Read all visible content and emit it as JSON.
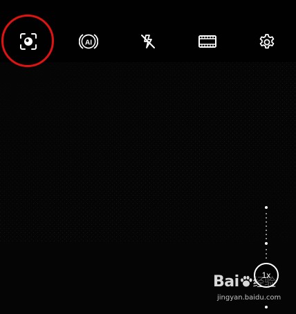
{
  "top_bar": {
    "items": [
      {
        "id": "portrait-focus",
        "icon": "face-frame-icon"
      },
      {
        "id": "ai",
        "icon": "ai-icon",
        "label": "AI"
      },
      {
        "id": "flash",
        "icon": "flash-off-icon"
      },
      {
        "id": "aspect",
        "icon": "film-frame-icon"
      },
      {
        "id": "settings",
        "icon": "gear-icon"
      }
    ],
    "highlight_color": "#e01212"
  },
  "zoom": {
    "level_label": "1x"
  },
  "watermark": {
    "logo_text_a": "Bai",
    "logo_text_b": "经验",
    "url": "jingyan.baidu.com"
  },
  "colors": {
    "background": "#000000",
    "icon": "#ffffff",
    "annotation": "#e01212"
  }
}
